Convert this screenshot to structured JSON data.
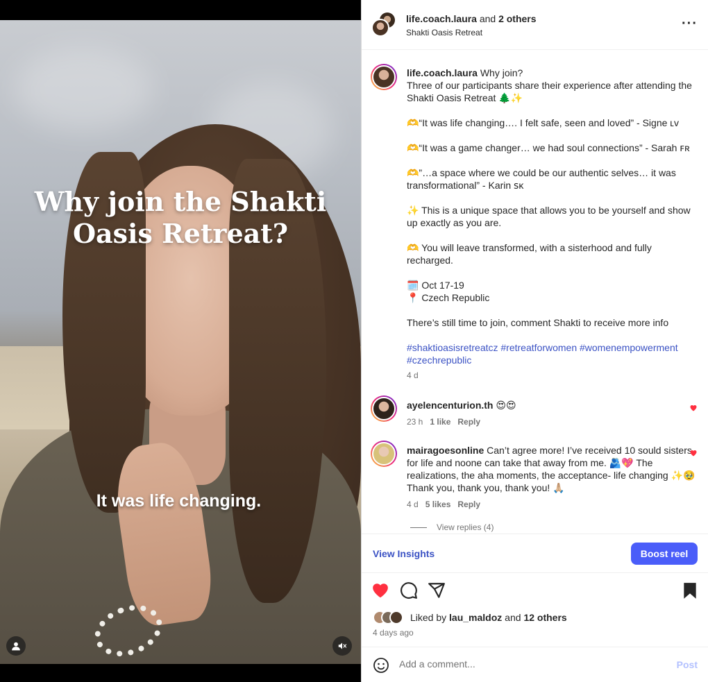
{
  "video": {
    "title_line1": "Why join the Shakti",
    "title_line2": "Oasis Retreat?",
    "caption": "It was life changing."
  },
  "header": {
    "username": "life.coach.laura",
    "and_others": " and ",
    "others_count": "2 others",
    "location": "Shakti Oasis Retreat"
  },
  "post": {
    "username": "life.coach.laura",
    "caption_lines": [
      "Why join?",
      "Three of our participants share their experience after attending the Shakti Oasis Retreat 🌲✨",
      "",
      "🫶“It was life changing…. I felt safe, seen and loved” - Signe ʟᴠ",
      "",
      "🫶“It was a game changer… we had soul connections” - Sarah ꜰʀ",
      "",
      "🫶”…a space where we could be our authentic selves… it was transformational” - Karin ꜱᴋ",
      "",
      "✨ This is a unique space that allows you to be yourself and show up exactly as you are.",
      "",
      "🫶 You will leave transformed, with a sisterhood and fully recharged.",
      "",
      "🗓️ Oct 17-19",
      "📍 Czech Republic",
      "",
      "There’s still time to join, comment Shakti to receive more info",
      ""
    ],
    "hashtags": "#shaktioasisretreatcz #retreatforwomen #womenempowerment #czechrepublic",
    "time": "4 d"
  },
  "comments": [
    {
      "username": "ayelencenturion.th",
      "text": " 😍😍",
      "time": "23 h",
      "likes": "1 like",
      "reply": "Reply"
    },
    {
      "username": "mairagoesonline",
      "text": " Can’t agree more! I’ve received 10 sould sisters for life and noone can take that away from me.  🫂💖 The realizations, the aha moments, the acceptance- life changing ✨🥹  Thank you, thank you, thank you! 🙏🏼",
      "time": "4 d",
      "likes": "5 likes",
      "reply": "Reply"
    }
  ],
  "view_replies": "View replies (4)",
  "insights": {
    "view_insights": "View Insights",
    "boost": "Boost reel"
  },
  "likes": {
    "prefix": "Liked by ",
    "user": "lau_maldoz",
    "mid": " and ",
    "others": "12 others"
  },
  "time_ago": "4 days ago",
  "comment_box": {
    "placeholder": "Add a comment...",
    "post": "Post"
  },
  "colors": {
    "accent": "#3b52c4",
    "boost": "#4a5df9",
    "heart": "#ff3040",
    "post_disabled": "#b3c1ff"
  },
  "icons": [
    "user-icon",
    "mute-icon",
    "more-icon",
    "heart-icon",
    "comment-icon",
    "share-icon",
    "bookmark-icon",
    "emoji-icon"
  ]
}
